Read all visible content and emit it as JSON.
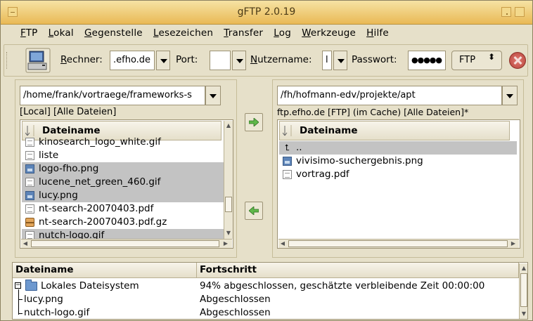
{
  "window": {
    "title": "gFTP 2.0.19"
  },
  "menu": [
    "FTP",
    "Lokal",
    "Gegenstelle",
    "Lesezeichen",
    "Transfer",
    "Log",
    "Werkzeuge",
    "Hilfe"
  ],
  "toolbar": {
    "host_label": "Rechner:",
    "host_value": ".efho.de",
    "port_label": "Port:",
    "port_value": "",
    "user_label": "Nutzername:",
    "user_value": "l",
    "pass_label": "Passwort:",
    "pass_value": "●●●●●",
    "protocol": "FTP",
    "protocol_arrows": "⬍"
  },
  "local": {
    "path": "/home/frank/vortraege/frameworks-s",
    "status": "[Local]  [Alle Dateien]",
    "column": "Dateiname",
    "files": [
      {
        "name": "kinosearch_logo_white.gif",
        "icon": "text-icon",
        "selected": false
      },
      {
        "name": "liste",
        "icon": "text-icon",
        "selected": false
      },
      {
        "name": "logo-fho.png",
        "icon": "image-icon",
        "selected": true
      },
      {
        "name": "lucene_net_green_460.gif",
        "icon": "text-icon",
        "selected": true
      },
      {
        "name": "lucy.png",
        "icon": "image-icon",
        "selected": true
      },
      {
        "name": "nt-search-20070403.pdf",
        "icon": "text-icon",
        "selected": false
      },
      {
        "name": "nt-search-20070403.pdf.gz",
        "icon": "archive-icon",
        "selected": false
      },
      {
        "name": "nutch-logo.gif",
        "icon": "text-icon",
        "selected": true
      }
    ]
  },
  "remote": {
    "path": "/fh/hofmann-edv/projekte/apt",
    "status": "ftp.efho.de [FTP]  (im Cache)  [Alle Dateien]*",
    "column": "Dateiname",
    "files": [
      {
        "name": "..",
        "icon": "up-icon",
        "selected": true
      },
      {
        "name": "vivisimo-suchergebnis.png",
        "icon": "image-icon",
        "selected": false
      },
      {
        "name": "vortrag.pdf",
        "icon": "text-icon",
        "selected": false
      }
    ]
  },
  "transfers": {
    "col_name": "Dateiname",
    "col_progress": "Fortschritt",
    "rows": [
      {
        "name": "Lokales Dateisystem",
        "progress": "94%  abgeschlossen, geschätzte verbleibende Zeit 00:00:00"
      },
      {
        "name": "lucy.png",
        "progress": "Abgeschlossen"
      },
      {
        "name": "nutch-logo.gif",
        "progress": "Abgeschlossen"
      }
    ]
  },
  "colors": {
    "titlebar": "#e9b955",
    "window_bg": "#e6e0c9",
    "selection": "#c3c3c3",
    "folder": "#6d98cf"
  }
}
